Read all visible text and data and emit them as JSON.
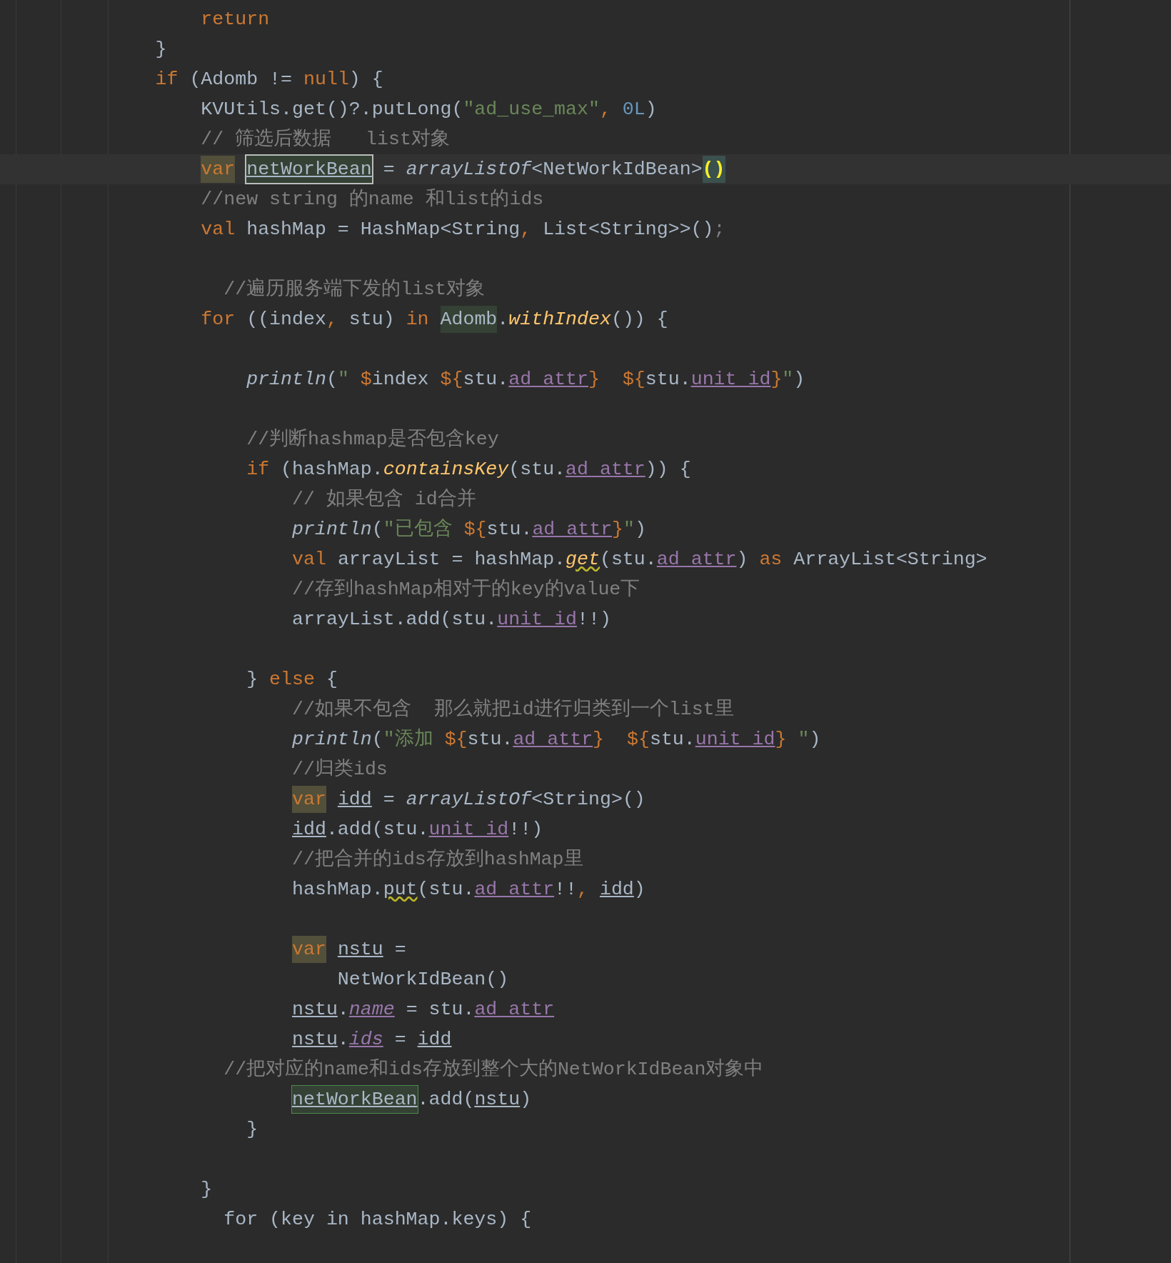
{
  "editor": {
    "lines": [
      {
        "kind": "code",
        "current": false,
        "tokens": [
          {
            "kind": "keyword",
            "text": "                return"
          }
        ]
      },
      {
        "kind": "code",
        "current": false,
        "tokens": [
          {
            "kind": "plain",
            "text": "            }"
          }
        ]
      },
      {
        "kind": "code",
        "current": false,
        "tokens": [
          {
            "kind": "keyword",
            "text": "            if"
          },
          {
            "kind": "plain",
            "text": " (Adomb != "
          },
          {
            "kind": "keyword",
            "text": "null"
          },
          {
            "kind": "plain",
            "text": ") {"
          }
        ]
      },
      {
        "kind": "code",
        "current": false,
        "tokens": [
          {
            "kind": "plain",
            "text": "                KVUtils.get()?.putLong("
          },
          {
            "kind": "string",
            "text": "\"ad_use_max\""
          },
          {
            "kind": "keyword",
            "text": ", "
          },
          {
            "kind": "number",
            "text": "0L"
          },
          {
            "kind": "plain",
            "text": ")"
          }
        ]
      },
      {
        "kind": "code",
        "current": false,
        "tokens": [
          {
            "kind": "comment",
            "text": "                // 筛选后数据   list对象"
          }
        ]
      },
      {
        "kind": "code",
        "current": true,
        "tokens": [
          {
            "kind": "keyword_marked",
            "text": "                var"
          },
          {
            "kind": "declaration",
            "text": " netWorkBean"
          },
          {
            "kind": "plain",
            "text": " = "
          },
          {
            "kind": "italic",
            "text": "arrayListOf"
          },
          {
            "kind": "plain",
            "text": "<NetWorkIdBean>"
          },
          {
            "kind": "brace_match",
            "text": "()"
          }
        ]
      },
      {
        "kind": "code",
        "current": false,
        "tokens": [
          {
            "kind": "comment",
            "text": "                //new string 的name 和list的ids"
          }
        ]
      },
      {
        "kind": "code",
        "current": false,
        "tokens": [
          {
            "kind": "keyword",
            "text": "                val"
          },
          {
            "kind": "plain",
            "text": " hashMap = HashMap<String"
          },
          {
            "kind": "keyword",
            "text": ", "
          },
          {
            "kind": "plain",
            "text": "List<String>>()"
          },
          {
            "kind": "comment",
            "text": ";"
          }
        ]
      },
      {
        "kind": "blank",
        "current": false
      },
      {
        "kind": "code",
        "current": false,
        "tokens": [
          {
            "kind": "comment",
            "text": "                  //遍历服务端下发的list对象"
          }
        ]
      },
      {
        "kind": "code",
        "current": false,
        "tokens": [
          {
            "kind": "keyword",
            "text": "                for"
          },
          {
            "kind": "plain",
            "text": " ((index"
          },
          {
            "kind": "keyword",
            "text": ", "
          },
          {
            "kind": "plain",
            "text": "stu) "
          },
          {
            "kind": "keyword",
            "text": "in"
          },
          {
            "kind": "usage",
            "text": " Adomb"
          },
          {
            "kind": "plain",
            "text": "."
          },
          {
            "kind": "function",
            "text": "withIndex"
          },
          {
            "kind": "plain",
            "text": "()) {"
          }
        ]
      },
      {
        "kind": "blank",
        "current": false
      },
      {
        "kind": "code",
        "current": false,
        "tokens": [
          {
            "kind": "italic",
            "text": "                    println"
          },
          {
            "kind": "plain",
            "text": "("
          },
          {
            "kind": "string",
            "text": "\" "
          },
          {
            "kind": "template",
            "text": "$"
          },
          {
            "kind": "plain",
            "text": "index"
          },
          {
            "kind": "template",
            "text": " ${"
          },
          {
            "kind": "plain",
            "text": "stu."
          },
          {
            "kind": "field",
            "text": "ad_attr"
          },
          {
            "kind": "template",
            "text": "}"
          },
          {
            "kind": "template",
            "text": "  ${"
          },
          {
            "kind": "plain",
            "text": "stu."
          },
          {
            "kind": "field",
            "text": "unit_id"
          },
          {
            "kind": "template",
            "text": "}"
          },
          {
            "kind": "string",
            "text": "\""
          },
          {
            "kind": "plain",
            "text": ")"
          }
        ]
      },
      {
        "kind": "blank",
        "current": false
      },
      {
        "kind": "code",
        "current": false,
        "tokens": [
          {
            "kind": "comment",
            "text": "                    //判断hashmap是否包含key"
          }
        ]
      },
      {
        "kind": "code",
        "current": false,
        "tokens": [
          {
            "kind": "keyword",
            "text": "                    if"
          },
          {
            "kind": "plain",
            "text": " (hashMap."
          },
          {
            "kind": "function",
            "text": "containsKey"
          },
          {
            "kind": "plain",
            "text": "(stu."
          },
          {
            "kind": "field",
            "text": "ad_attr"
          },
          {
            "kind": "plain",
            "text": ")) {"
          }
        ]
      },
      {
        "kind": "code",
        "current": false,
        "tokens": [
          {
            "kind": "comment",
            "text": "                        // 如果包含 id合并"
          }
        ]
      },
      {
        "kind": "code",
        "current": false,
        "tokens": [
          {
            "kind": "italic",
            "text": "                        println"
          },
          {
            "kind": "plain",
            "text": "("
          },
          {
            "kind": "string",
            "text": "\"已包含 "
          },
          {
            "kind": "template",
            "text": "${"
          },
          {
            "kind": "plain",
            "text": "stu."
          },
          {
            "kind": "field",
            "text": "ad_attr"
          },
          {
            "kind": "template",
            "text": "}"
          },
          {
            "kind": "string",
            "text": "\""
          },
          {
            "kind": "plain",
            "text": ")"
          }
        ]
      },
      {
        "kind": "code",
        "current": false,
        "tokens": [
          {
            "kind": "keyword",
            "text": "                        val"
          },
          {
            "kind": "plain",
            "text": " arrayList = hashMap."
          },
          {
            "kind": "function_warning",
            "text": "get"
          },
          {
            "kind": "plain",
            "text": "(stu."
          },
          {
            "kind": "field",
            "text": "ad_attr"
          },
          {
            "kind": "plain",
            "text": ") "
          },
          {
            "kind": "keyword",
            "text": "as"
          },
          {
            "kind": "plain",
            "text": " ArrayList<String>"
          }
        ]
      },
      {
        "kind": "code",
        "current": false,
        "tokens": [
          {
            "kind": "comment",
            "text": "                        //存到hashMap相对于的key的value下"
          }
        ]
      },
      {
        "kind": "code",
        "current": false,
        "tokens": [
          {
            "kind": "plain",
            "text": "                        arrayList.add(stu."
          },
          {
            "kind": "field",
            "text": "unit_id"
          },
          {
            "kind": "plain",
            "text": "!!)"
          }
        ]
      },
      {
        "kind": "blank",
        "current": false
      },
      {
        "kind": "code",
        "current": false,
        "tokens": [
          {
            "kind": "plain",
            "text": "                    } "
          },
          {
            "kind": "keyword",
            "text": "else"
          },
          {
            "kind": "plain",
            "text": " {"
          }
        ]
      },
      {
        "kind": "code",
        "current": false,
        "tokens": [
          {
            "kind": "comment",
            "text": "                        //如果不包含  那么就把id进行归类到一个list里"
          }
        ]
      },
      {
        "kind": "code",
        "current": false,
        "tokens": [
          {
            "kind": "italic",
            "text": "                        println"
          },
          {
            "kind": "plain",
            "text": "("
          },
          {
            "kind": "string",
            "text": "\"添加 "
          },
          {
            "kind": "template",
            "text": "${"
          },
          {
            "kind": "plain",
            "text": "stu."
          },
          {
            "kind": "field",
            "text": "ad_attr"
          },
          {
            "kind": "template",
            "text": "}"
          },
          {
            "kind": "template",
            "text": "  ${"
          },
          {
            "kind": "plain",
            "text": "stu."
          },
          {
            "kind": "field",
            "text": "unit_id"
          },
          {
            "kind": "template",
            "text": "}"
          },
          {
            "kind": "string",
            "text": " \""
          },
          {
            "kind": "plain",
            "text": ")"
          }
        ]
      },
      {
        "kind": "code",
        "current": false,
        "tokens": [
          {
            "kind": "comment",
            "text": "                        //归类ids"
          }
        ]
      },
      {
        "kind": "code",
        "current": false,
        "tokens": [
          {
            "kind": "keyword_marked",
            "text": "                        var"
          },
          {
            "kind": "variable",
            "text": " idd"
          },
          {
            "kind": "plain",
            "text": " = "
          },
          {
            "kind": "italic",
            "text": "arrayListOf"
          },
          {
            "kind": "plain",
            "text": "<String>()"
          }
        ]
      },
      {
        "kind": "code",
        "current": false,
        "tokens": [
          {
            "kind": "variable",
            "text": "                        idd"
          },
          {
            "kind": "plain",
            "text": ".add(stu."
          },
          {
            "kind": "field",
            "text": "unit_id"
          },
          {
            "kind": "plain",
            "text": "!!)"
          }
        ]
      },
      {
        "kind": "code",
        "current": false,
        "tokens": [
          {
            "kind": "comment",
            "text": "                        //把合并的ids存放到hashMap里"
          }
        ]
      },
      {
        "kind": "code",
        "current": false,
        "tokens": [
          {
            "kind": "plain",
            "text": "                        hashMap."
          },
          {
            "kind": "plain_warning",
            "text": "put"
          },
          {
            "kind": "plain",
            "text": "(stu."
          },
          {
            "kind": "field",
            "text": "ad_attr"
          },
          {
            "kind": "plain",
            "text": "!!"
          },
          {
            "kind": "keyword",
            "text": ", "
          },
          {
            "kind": "variable",
            "text": "idd"
          },
          {
            "kind": "plain",
            "text": ")"
          }
        ]
      },
      {
        "kind": "blank",
        "current": false
      },
      {
        "kind": "code",
        "current": false,
        "tokens": [
          {
            "kind": "keyword_marked",
            "text": "                        var"
          },
          {
            "kind": "variable",
            "text": " nstu"
          },
          {
            "kind": "plain",
            "text": " ="
          }
        ]
      },
      {
        "kind": "code",
        "current": false,
        "tokens": [
          {
            "kind": "plain",
            "text": "                            NetWorkIdBean()"
          }
        ]
      },
      {
        "kind": "code",
        "current": false,
        "tokens": [
          {
            "kind": "variable",
            "text": "                        nstu"
          },
          {
            "kind": "plain",
            "text": "."
          },
          {
            "kind": "field_italic",
            "text": "name"
          },
          {
            "kind": "plain",
            "text": " = stu."
          },
          {
            "kind": "field",
            "text": "ad_attr"
          }
        ]
      },
      {
        "kind": "code",
        "current": false,
        "tokens": [
          {
            "kind": "variable",
            "text": "                        nstu"
          },
          {
            "kind": "plain",
            "text": "."
          },
          {
            "kind": "field_italic",
            "text": "ids"
          },
          {
            "kind": "plain",
            "text": " = "
          },
          {
            "kind": "variable",
            "text": "idd"
          }
        ]
      },
      {
        "kind": "code",
        "current": false,
        "tokens": [
          {
            "kind": "comment",
            "text": "                  //把对应的name和ids存放到整个大的NetWorkIdBean对象中"
          }
        ]
      },
      {
        "kind": "code",
        "current": false,
        "tokens": [
          {
            "kind": "write_usage",
            "text": "                        netWorkBean"
          },
          {
            "kind": "plain",
            "text": ".add("
          },
          {
            "kind": "variable",
            "text": "nstu"
          },
          {
            "kind": "plain",
            "text": ")"
          }
        ]
      },
      {
        "kind": "code",
        "current": false,
        "tokens": [
          {
            "kind": "plain",
            "text": "                    }"
          }
        ]
      },
      {
        "kind": "blank",
        "current": false
      },
      {
        "kind": "code",
        "current": false,
        "tokens": [
          {
            "kind": "plain",
            "text": "                }"
          }
        ]
      },
      {
        "kind": "code",
        "current": false,
        "tokens": [
          {
            "kind": "plain",
            "text": "                  for (key in hashMap.keys) {"
          }
        ]
      }
    ]
  }
}
